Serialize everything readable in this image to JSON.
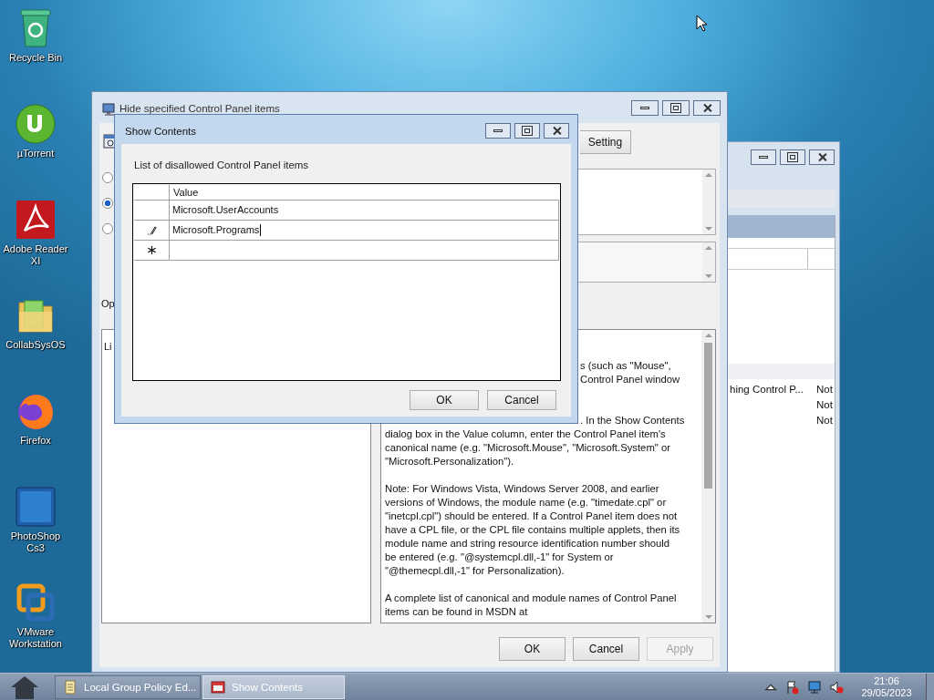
{
  "desktop_icons": [
    {
      "label": "Recycle Bin",
      "kind": "recycle"
    },
    {
      "label": "µTorrent",
      "kind": "torrent"
    },
    {
      "label": "Adobe Reader XI",
      "kind": "pdf"
    },
    {
      "label": "CollabSysOS",
      "kind": "folder"
    },
    {
      "label": "Firefox",
      "kind": "firefox"
    },
    {
      "label": "PhotoShop Cs3",
      "kind": "photoshop"
    },
    {
      "label": "VMware Workstation",
      "kind": "vmware"
    }
  ],
  "back_window": {
    "rows": [
      {
        "column_1": "hing Control P...",
        "column_2": "Not"
      },
      {
        "column_2": "Not"
      },
      {
        "column_2": "Not"
      }
    ]
  },
  "policy_window": {
    "title": "Hide specified Control Panel items",
    "setting_button": "Setting",
    "radios": [
      {
        "selected": false
      },
      {
        "selected": true
      },
      {
        "selected": false
      }
    ],
    "options_label": "Op",
    "options_text": "Li",
    "help": [
      {
        "lines": [
          {
            "text": "s (such as \"Mouse\",",
            "kind": "partial"
          },
          {
            "text": "Control Panel window",
            "kind": "partial"
          }
        ]
      },
      {
        "lines": [
          {
            "text": ". In the Show Contents",
            "kind": "partial"
          },
          {
            "text": "dialog box in the Value column, enter the Control Panel item's",
            "kind": "full"
          },
          {
            "text": "canonical name (e.g. \"Microsoft.Mouse\", \"Microsoft.System\" or",
            "kind": "full"
          },
          {
            "text": "\"Microsoft.Personalization\").",
            "kind": "full"
          }
        ]
      },
      {
        "lines": [
          {
            "text": "Note: For Windows Vista, Windows Server 2008, and earlier",
            "kind": "full"
          },
          {
            "text": "versions of Windows, the module name (e.g. \"timedate.cpl\" or",
            "kind": "full"
          },
          {
            "text": "\"inetcpl.cpl\") should be entered. If a Control Panel item does not",
            "kind": "full"
          },
          {
            "text": "have a CPL file, or the CPL file contains multiple applets, then its",
            "kind": "full"
          },
          {
            "text": "module name and string resource identification number should",
            "kind": "full"
          },
          {
            "text": "be entered (e.g. \"@systemcpl.dll,-1\" for System or",
            "kind": "full"
          },
          {
            "text": "\"@themecpl.dll,-1\" for Personalization).",
            "kind": "full"
          }
        ]
      },
      {
        "lines": [
          {
            "text": "A complete list of canonical and module names of Control Panel",
            "kind": "full"
          },
          {
            "text": "items can be found in MSDN at",
            "kind": "full"
          }
        ]
      }
    ],
    "buttons": [
      {
        "label": "OK",
        "disabled": false
      },
      {
        "label": "Cancel",
        "disabled": false
      },
      {
        "label": "Apply",
        "disabled": true
      }
    ]
  },
  "dialog": {
    "title": "Show Contents",
    "label": "List of disallowed Control Panel items",
    "column": "Value",
    "rows": [
      {
        "value": "Microsoft.UserAccounts",
        "kind": "plain"
      },
      {
        "value": "Microsoft.Programs",
        "kind": "editing"
      },
      {
        "kind": "new"
      }
    ],
    "buttons": [
      "OK",
      "Cancel"
    ]
  },
  "taskbar": {
    "tasks": [
      {
        "label": "Local Group Policy Ed...",
        "kind": "editor",
        "selected": false
      },
      {
        "label": "Show Contents",
        "kind": "dialog",
        "selected": true
      }
    ],
    "time": "21:06",
    "date": "29/05/2023"
  }
}
